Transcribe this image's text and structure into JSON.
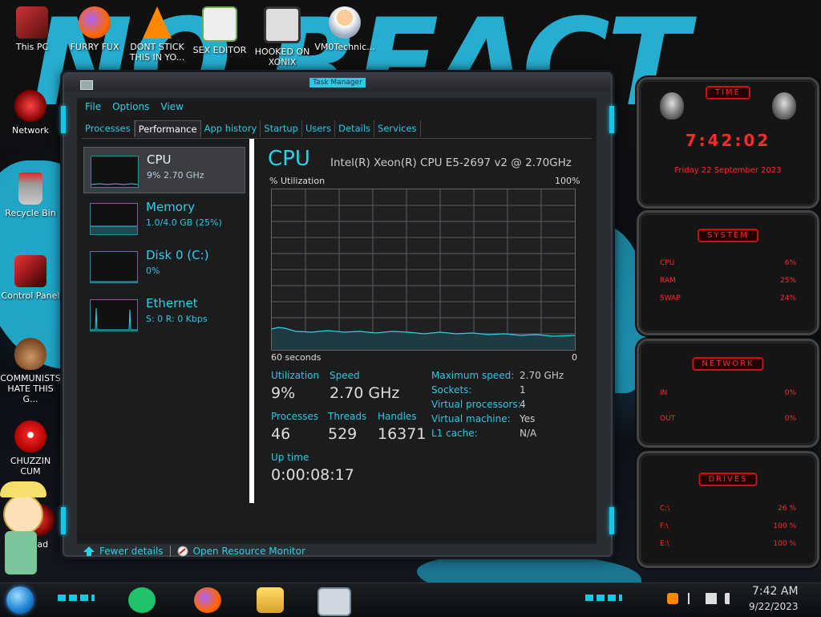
{
  "desktop": {
    "wallpaper_text": "NO REACT",
    "icons": [
      {
        "label": "This PC",
        "icon": "computer-icon"
      },
      {
        "label": "FURRY FUX",
        "icon": "firefox-icon"
      },
      {
        "label": "DONT STICK THIS IN YO...",
        "icon": "vlc-cone-icon"
      },
      {
        "label": "SEX EDITOR",
        "icon": "hxd-icon"
      },
      {
        "label": "HOOKED ON XONIX",
        "icon": "xonix-game-icon"
      },
      {
        "label": "VM0Technic...",
        "icon": "doctor-icon"
      },
      {
        "label": "Network",
        "icon": "network-icon"
      },
      {
        "label": "Recycle Bin",
        "icon": "recycle-bin-icon"
      },
      {
        "label": "Control Panel",
        "icon": "control-panel-icon"
      },
      {
        "label": "COMMUNISTS HATE THIS G...",
        "icon": "money-bag-icon"
      },
      {
        "label": "CHUZZIN CUM",
        "icon": "chuzzle-icon"
      },
      {
        "label": "...ad",
        "icon": "red-ball-icon"
      }
    ]
  },
  "taskmgr": {
    "title": "Task Manager",
    "menu": [
      "File",
      "Options",
      "View"
    ],
    "tabs": [
      "Processes",
      "Performance",
      "App history",
      "Startup",
      "Users",
      "Details",
      "Services"
    ],
    "active_tab": "Performance",
    "resources": [
      {
        "name": "CPU",
        "sub": "9%  2.70 GHz"
      },
      {
        "name": "Memory",
        "sub": "1.0/4.0 GB (25%)"
      },
      {
        "name": "Disk 0 (C:)",
        "sub": "0%"
      },
      {
        "name": "Ethernet",
        "sub": "S: 0  R: 0 Kbps"
      }
    ],
    "cpu": {
      "title": "CPU",
      "model": "Intel(R) Xeon(R) CPU E5-2697 v2 @ 2.70GHz",
      "util_label": "% Utilization",
      "util_max": "100%",
      "x_left": "60 seconds",
      "x_right": "0",
      "utilization_label": "Utilization",
      "utilization": "9%",
      "speed_label": "Speed",
      "speed": "2.70 GHz",
      "processes_label": "Processes",
      "processes": "46",
      "threads_label": "Threads",
      "threads": "529",
      "handles_label": "Handles",
      "handles": "16371",
      "uptime_label": "Up time",
      "uptime": "0:00:08:17",
      "specs": [
        {
          "key": "Maximum speed:",
          "value": "2.70 GHz"
        },
        {
          "key": "Sockets:",
          "value": "1"
        },
        {
          "key": "Virtual processors:",
          "value": "4"
        },
        {
          "key": "Virtual machine:",
          "value": "Yes"
        },
        {
          "key": "L1 cache:",
          "value": "N/A"
        }
      ]
    },
    "footer": {
      "fewer": "Fewer details",
      "monitor": "Open Resource Monitor"
    }
  },
  "widgets": {
    "time": {
      "head": "TIME",
      "clock": "7:42:02",
      "date": "Friday 22 September 2023"
    },
    "system": {
      "head": "SYSTEM",
      "rows": [
        {
          "k": "CPU",
          "v": "6%"
        },
        {
          "k": "RAM",
          "v": "25%"
        },
        {
          "k": "SWAP",
          "v": "24%"
        }
      ]
    },
    "network": {
      "head": "NETWORK",
      "rows": [
        {
          "k": "IN",
          "v": "0%"
        },
        {
          "k": "OUT",
          "v": "0%"
        }
      ]
    },
    "drives": {
      "head": "DRIVES",
      "rows": [
        {
          "k": "C:\\",
          "v": "26 %"
        },
        {
          "k": "F:\\",
          "v": "100 %"
        },
        {
          "k": "E:\\",
          "v": "100 %"
        }
      ]
    }
  },
  "taskbar": {
    "time": "7:42 AM",
    "date": "9/22/2023",
    "apps": [
      "notes-app-icon",
      "firefox-icon",
      "file-explorer-icon",
      "task-manager-icon"
    ]
  },
  "colors": {
    "accent": "#2ed0e6",
    "widget_red": "#ff2a2a"
  }
}
